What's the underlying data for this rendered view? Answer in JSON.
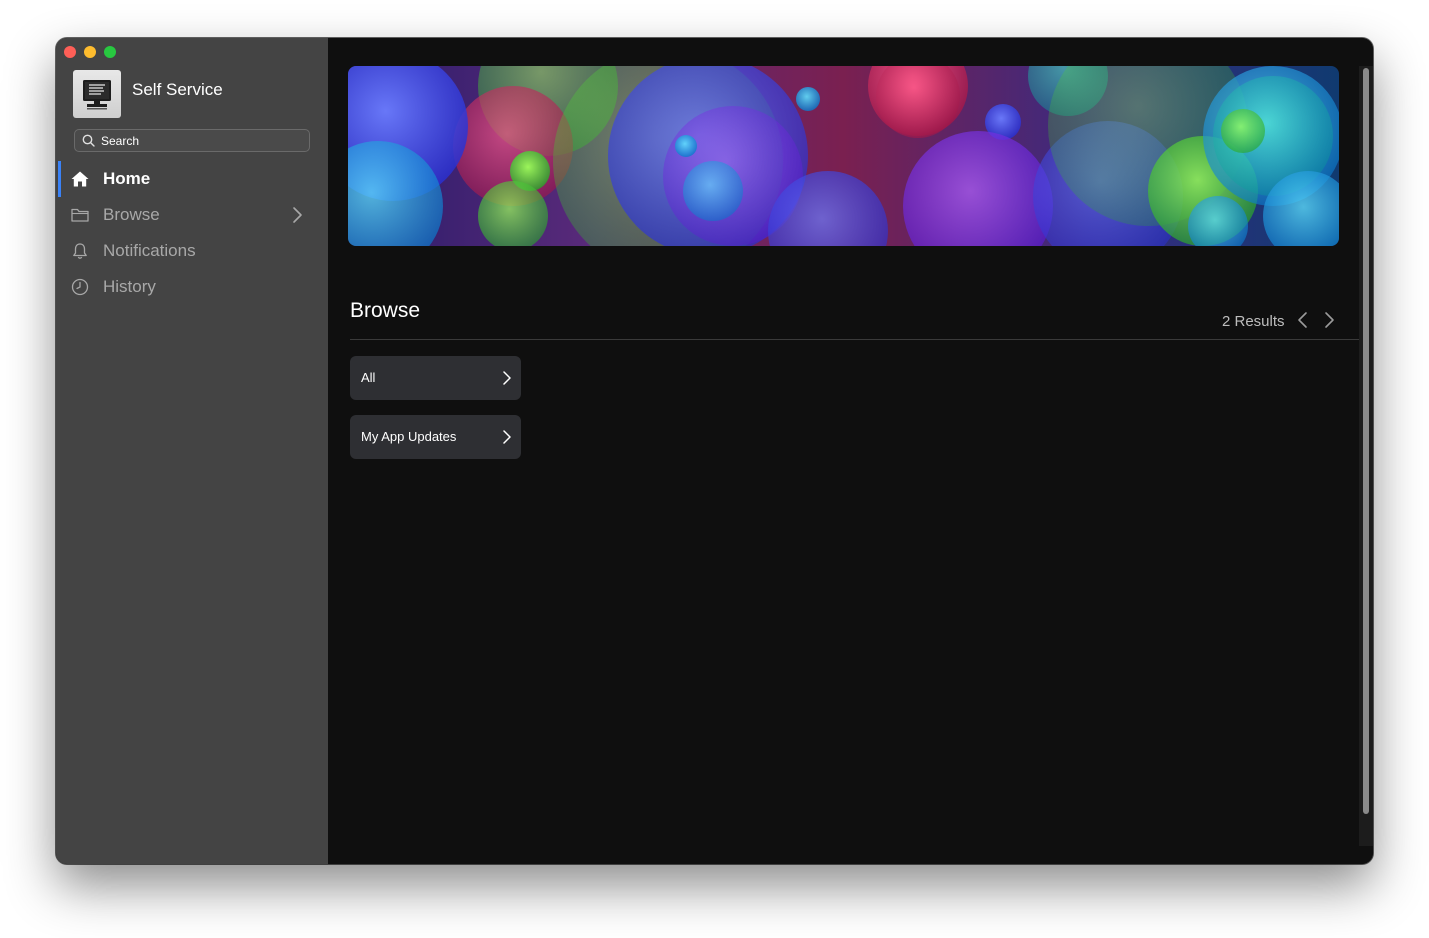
{
  "window": {
    "controls": [
      "close",
      "minimize",
      "zoom"
    ]
  },
  "app": {
    "title": "Self Service",
    "logo_icon": "computer-monitor-icon"
  },
  "search": {
    "placeholder": "Search"
  },
  "sidebar": {
    "items": [
      {
        "label": "Home",
        "icon": "home-icon",
        "active": true
      },
      {
        "label": "Browse",
        "icon": "folder-icon",
        "active": false,
        "has_chevron": true
      },
      {
        "label": "Notifications",
        "icon": "bell-icon",
        "active": false
      },
      {
        "label": "History",
        "icon": "clock-icon",
        "active": false
      }
    ]
  },
  "main": {
    "section_title": "Browse",
    "results_text": "2 Results",
    "categories": [
      {
        "label": "All"
      },
      {
        "label": "My App Updates"
      }
    ]
  },
  "colors": {
    "sidebar_bg": "#444444",
    "main_bg": "#0f0f0f",
    "accent": "#3a82f7",
    "card_bg": "#2e2f33"
  }
}
